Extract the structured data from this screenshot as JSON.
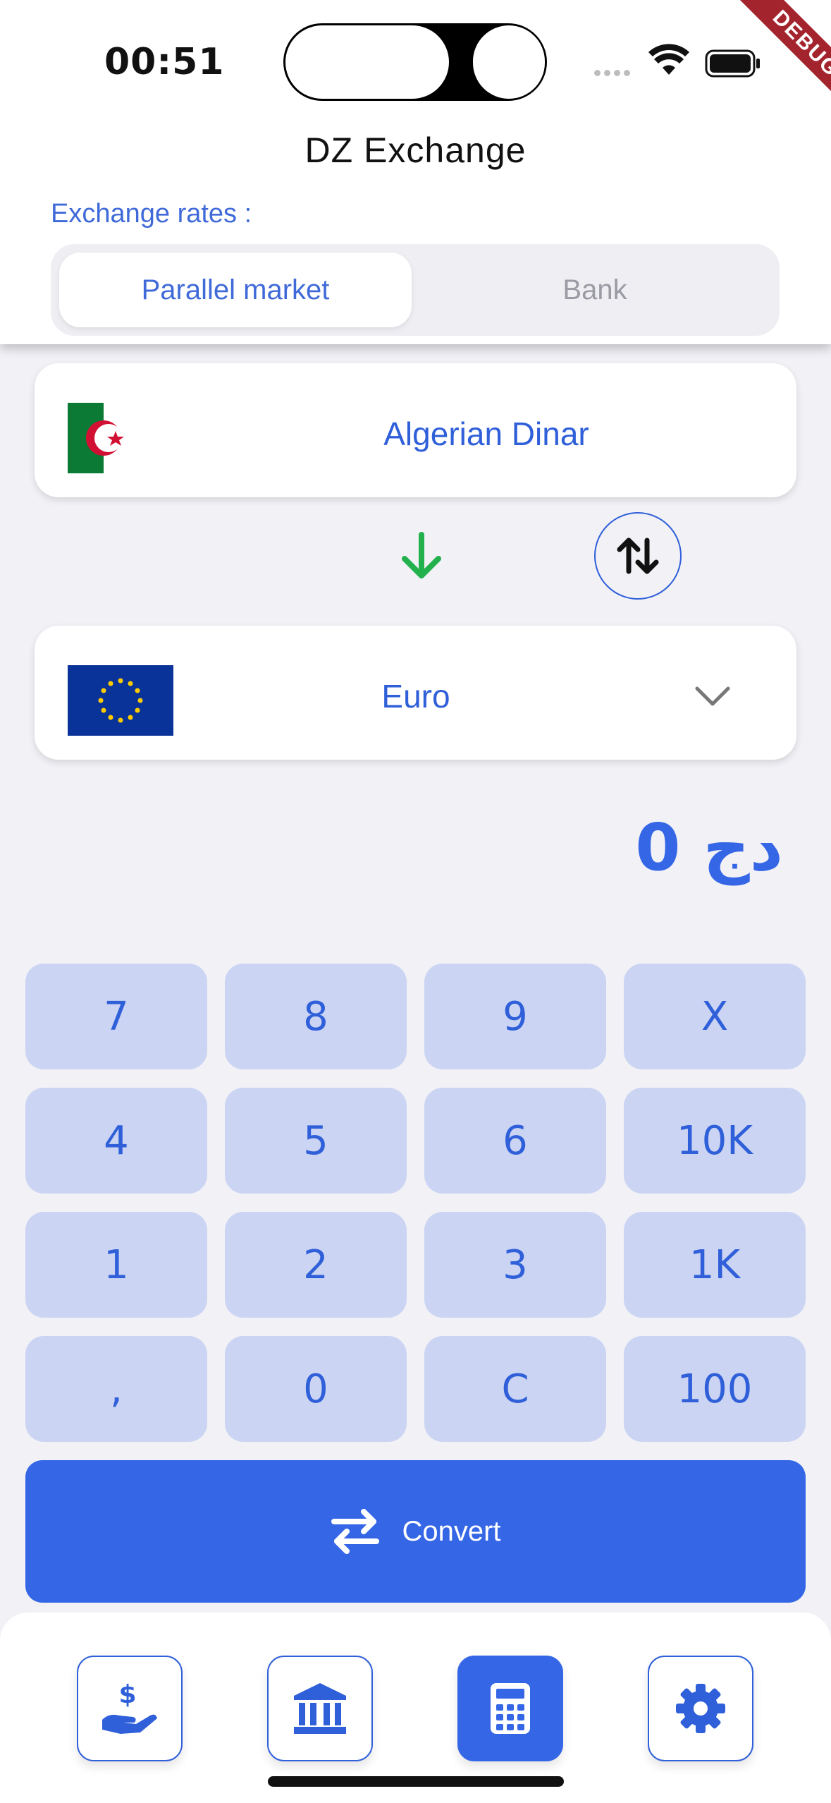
{
  "status_bar": {
    "time": "00:51",
    "debug_label": "DEBUG"
  },
  "header": {
    "title": "DZ Exchange",
    "rates_label": "Exchange rates :",
    "segments": [
      {
        "label": "Parallel market",
        "selected": true
      },
      {
        "label": "Bank",
        "selected": false
      }
    ]
  },
  "converter": {
    "from_currency": "Algerian Dinar",
    "to_currency": "Euro",
    "amount": "0 دج"
  },
  "keypad": {
    "keys": [
      "7",
      "8",
      "9",
      "X",
      "4",
      "5",
      "6",
      "10K",
      "1",
      "2",
      "3",
      "1K",
      ",",
      "0",
      "C",
      "100"
    ]
  },
  "convert": {
    "label": "Convert"
  },
  "bottom_nav": {
    "items": [
      {
        "icon": "hand-dollar-icon",
        "active": false
      },
      {
        "icon": "bank-icon",
        "active": false
      },
      {
        "icon": "calculator-icon",
        "active": true
      },
      {
        "icon": "gear-icon",
        "active": false
      }
    ]
  },
  "colors": {
    "accent": "#3566e6",
    "key_bg": "#cbd5f3",
    "label_blue": "#3f6ad8",
    "arrow_green": "#22b14c",
    "debug_red": "#a4242d"
  }
}
